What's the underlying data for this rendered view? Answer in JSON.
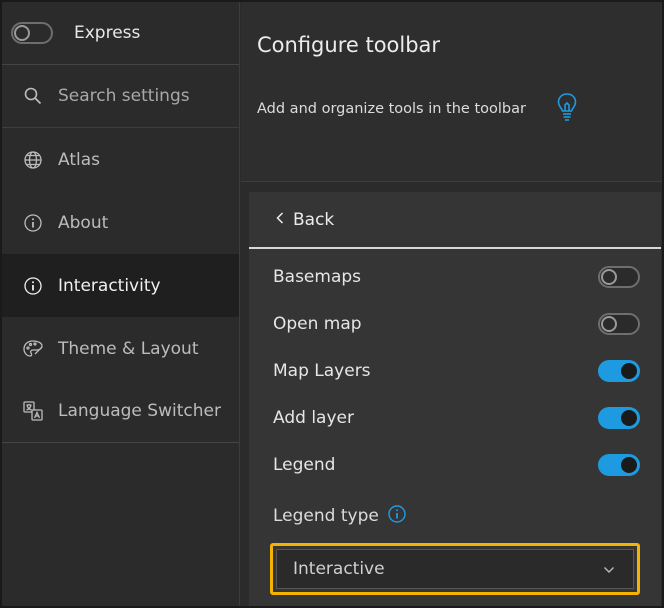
{
  "sidebar": {
    "express": {
      "label": "Express",
      "enabled": false
    },
    "search": {
      "placeholder": "Search settings",
      "icon": "search-icon"
    },
    "items": [
      {
        "label": "Atlas",
        "icon": "globe-icon",
        "active": false
      },
      {
        "label": "About",
        "icon": "info-icon",
        "active": false
      },
      {
        "label": "Interactivity",
        "icon": "info-icon",
        "active": true
      },
      {
        "label": "Theme & Layout",
        "icon": "palette-icon",
        "active": false
      },
      {
        "label": "Language Switcher",
        "icon": "translate-icon",
        "active": false
      }
    ]
  },
  "header": {
    "title": "Configure toolbar",
    "subtitle": "Add and organize tools in the toolbar",
    "tip_icon": "lightbulb-icon"
  },
  "panel": {
    "back_label": "Back",
    "tools": [
      {
        "label": "Basemaps",
        "enabled": false
      },
      {
        "label": "Open map",
        "enabled": false
      },
      {
        "label": "Map Layers",
        "enabled": true
      },
      {
        "label": "Add layer",
        "enabled": true
      },
      {
        "label": "Legend",
        "enabled": true
      }
    ],
    "legend_type_label": "Legend type",
    "legend_type_value": "Interactive"
  },
  "colors": {
    "accent": "#1e9be0",
    "highlight": "#f5b301",
    "background": "#2b2b2b"
  }
}
